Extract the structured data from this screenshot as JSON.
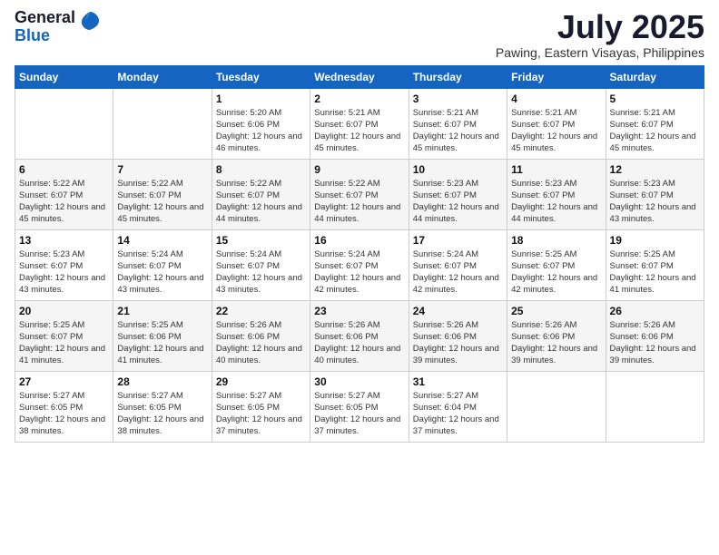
{
  "logo": {
    "general": "General",
    "blue": "Blue"
  },
  "title": {
    "month_year": "July 2025",
    "location": "Pawing, Eastern Visayas, Philippines"
  },
  "days_of_week": [
    "Sunday",
    "Monday",
    "Tuesday",
    "Wednesday",
    "Thursday",
    "Friday",
    "Saturday"
  ],
  "weeks": [
    [
      {
        "day": "",
        "info": ""
      },
      {
        "day": "",
        "info": ""
      },
      {
        "day": "1",
        "info": "Sunrise: 5:20 AM\nSunset: 6:06 PM\nDaylight: 12 hours and 46 minutes."
      },
      {
        "day": "2",
        "info": "Sunrise: 5:21 AM\nSunset: 6:07 PM\nDaylight: 12 hours and 45 minutes."
      },
      {
        "day": "3",
        "info": "Sunrise: 5:21 AM\nSunset: 6:07 PM\nDaylight: 12 hours and 45 minutes."
      },
      {
        "day": "4",
        "info": "Sunrise: 5:21 AM\nSunset: 6:07 PM\nDaylight: 12 hours and 45 minutes."
      },
      {
        "day": "5",
        "info": "Sunrise: 5:21 AM\nSunset: 6:07 PM\nDaylight: 12 hours and 45 minutes."
      }
    ],
    [
      {
        "day": "6",
        "info": "Sunrise: 5:22 AM\nSunset: 6:07 PM\nDaylight: 12 hours and 45 minutes."
      },
      {
        "day": "7",
        "info": "Sunrise: 5:22 AM\nSunset: 6:07 PM\nDaylight: 12 hours and 45 minutes."
      },
      {
        "day": "8",
        "info": "Sunrise: 5:22 AM\nSunset: 6:07 PM\nDaylight: 12 hours and 44 minutes."
      },
      {
        "day": "9",
        "info": "Sunrise: 5:22 AM\nSunset: 6:07 PM\nDaylight: 12 hours and 44 minutes."
      },
      {
        "day": "10",
        "info": "Sunrise: 5:23 AM\nSunset: 6:07 PM\nDaylight: 12 hours and 44 minutes."
      },
      {
        "day": "11",
        "info": "Sunrise: 5:23 AM\nSunset: 6:07 PM\nDaylight: 12 hours and 44 minutes."
      },
      {
        "day": "12",
        "info": "Sunrise: 5:23 AM\nSunset: 6:07 PM\nDaylight: 12 hours and 43 minutes."
      }
    ],
    [
      {
        "day": "13",
        "info": "Sunrise: 5:23 AM\nSunset: 6:07 PM\nDaylight: 12 hours and 43 minutes."
      },
      {
        "day": "14",
        "info": "Sunrise: 5:24 AM\nSunset: 6:07 PM\nDaylight: 12 hours and 43 minutes."
      },
      {
        "day": "15",
        "info": "Sunrise: 5:24 AM\nSunset: 6:07 PM\nDaylight: 12 hours and 43 minutes."
      },
      {
        "day": "16",
        "info": "Sunrise: 5:24 AM\nSunset: 6:07 PM\nDaylight: 12 hours and 42 minutes."
      },
      {
        "day": "17",
        "info": "Sunrise: 5:24 AM\nSunset: 6:07 PM\nDaylight: 12 hours and 42 minutes."
      },
      {
        "day": "18",
        "info": "Sunrise: 5:25 AM\nSunset: 6:07 PM\nDaylight: 12 hours and 42 minutes."
      },
      {
        "day": "19",
        "info": "Sunrise: 5:25 AM\nSunset: 6:07 PM\nDaylight: 12 hours and 41 minutes."
      }
    ],
    [
      {
        "day": "20",
        "info": "Sunrise: 5:25 AM\nSunset: 6:07 PM\nDaylight: 12 hours and 41 minutes."
      },
      {
        "day": "21",
        "info": "Sunrise: 5:25 AM\nSunset: 6:06 PM\nDaylight: 12 hours and 41 minutes."
      },
      {
        "day": "22",
        "info": "Sunrise: 5:26 AM\nSunset: 6:06 PM\nDaylight: 12 hours and 40 minutes."
      },
      {
        "day": "23",
        "info": "Sunrise: 5:26 AM\nSunset: 6:06 PM\nDaylight: 12 hours and 40 minutes."
      },
      {
        "day": "24",
        "info": "Sunrise: 5:26 AM\nSunset: 6:06 PM\nDaylight: 12 hours and 39 minutes."
      },
      {
        "day": "25",
        "info": "Sunrise: 5:26 AM\nSunset: 6:06 PM\nDaylight: 12 hours and 39 minutes."
      },
      {
        "day": "26",
        "info": "Sunrise: 5:26 AM\nSunset: 6:06 PM\nDaylight: 12 hours and 39 minutes."
      }
    ],
    [
      {
        "day": "27",
        "info": "Sunrise: 5:27 AM\nSunset: 6:05 PM\nDaylight: 12 hours and 38 minutes."
      },
      {
        "day": "28",
        "info": "Sunrise: 5:27 AM\nSunset: 6:05 PM\nDaylight: 12 hours and 38 minutes."
      },
      {
        "day": "29",
        "info": "Sunrise: 5:27 AM\nSunset: 6:05 PM\nDaylight: 12 hours and 37 minutes."
      },
      {
        "day": "30",
        "info": "Sunrise: 5:27 AM\nSunset: 6:05 PM\nDaylight: 12 hours and 37 minutes."
      },
      {
        "day": "31",
        "info": "Sunrise: 5:27 AM\nSunset: 6:04 PM\nDaylight: 12 hours and 37 minutes."
      },
      {
        "day": "",
        "info": ""
      },
      {
        "day": "",
        "info": ""
      }
    ]
  ]
}
